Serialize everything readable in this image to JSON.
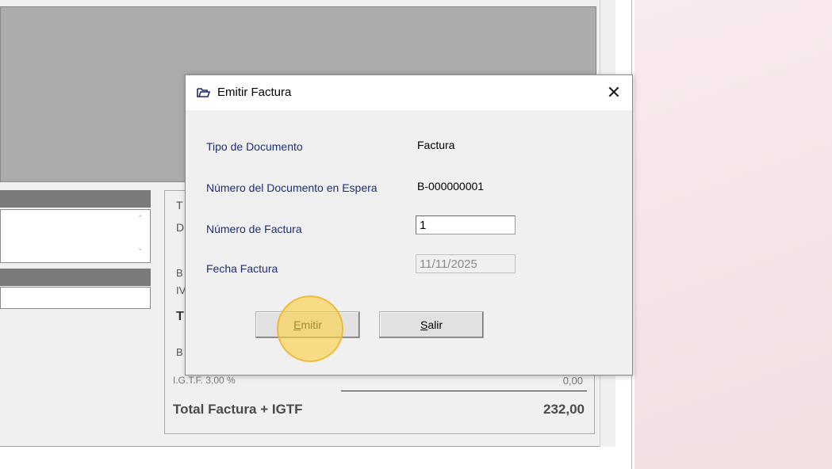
{
  "background": {
    "summary_fragments": [
      "T",
      "D",
      "B",
      "IV",
      "T",
      "B"
    ],
    "igtf_label": "I.G.T.F. 3,00 %",
    "igtf_value": "0,00",
    "total_label": "Total Factura + IGTF",
    "total_value": "232,00",
    "scroll_up_icon": "chevron-up-icon",
    "scroll_down_icon": "chevron-down-icon"
  },
  "dialog": {
    "title": "Emitir Factura",
    "close_icon": "close-icon",
    "fields": {
      "tipo_label": "Tipo de Documento",
      "tipo_value": "Factura",
      "espera_label": "Número del Documento en Espera",
      "espera_value": "B-000000001",
      "numero_label": "Número de Factura",
      "numero_value": "1",
      "fecha_label": "Fecha Factura",
      "fecha_value": "11/11/2025"
    },
    "buttons": {
      "emitir_hotkey": "E",
      "emitir_rest": "mitir",
      "salir_hotkey": "S",
      "salir_rest": "alir"
    }
  },
  "colors": {
    "label_color": "#1c2e7a",
    "highlight": "#fcd04b"
  }
}
